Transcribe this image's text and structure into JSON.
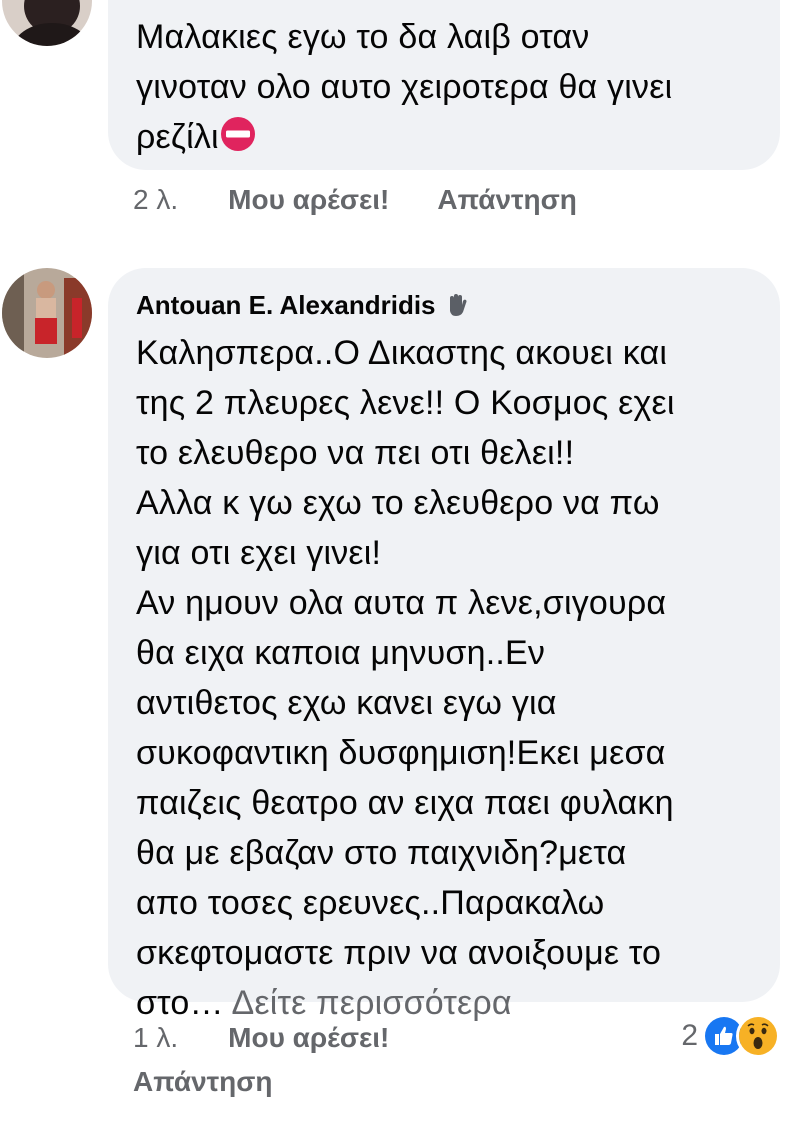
{
  "comment1": {
    "text": "Μαλακιες εγω το δα λαιβ οταν\nγινοταν ολο αυτο χειροτερα θα γινει\nρεζίλι",
    "emoji": "no-entry-icon",
    "time": "2 λ.",
    "like_label": "Μου αρέσει!",
    "reply_label": "Απάντηση"
  },
  "comment2": {
    "author": "Antouan E. Alexandridis",
    "author_badge": "waving-hand-icon",
    "text": "Καλησπερα..Ο Δικαστης ακουει και\nτης 2 πλευρες λενε!! Ο Κοσμος εχει\nτο ελευθερο να πει οτι θελει!!\nΑλλα κ γω εχω το ελευθερο να πω\nγια οτι εχει γινει!\nΑν ημουν ολα αυτα π λενε,σιγουρα\nθα ειχα καποια μηνυση..Εν\nαντιθετος εχω κανει εγω για\nσυκοφαντικη δυσφημιση!Εκει μεσα\nπαιζεις θεατρο αν ειχα παει φυλακη\nθα με εβαζαν στο παιχνιδη?μετα\nαπο τοσες ερευνες..Παρακαλω\nσκεφτομαστε πριν να ανοιξουμε το\nστο…",
    "see_more": "Δείτε περισσότερα",
    "time": "1 λ.",
    "like_label": "Μου αρέσει!",
    "reply_label": "Απάντηση",
    "reaction_count": "2",
    "reactions": [
      "like-icon",
      "wow-icon"
    ]
  },
  "colors": {
    "bubble": "#f0f2f5",
    "text": "#050505",
    "secondary": "#65676b",
    "like_blue": "#1877f2",
    "wow_yellow": "#f7b125",
    "stop_red": "#e0245e"
  }
}
